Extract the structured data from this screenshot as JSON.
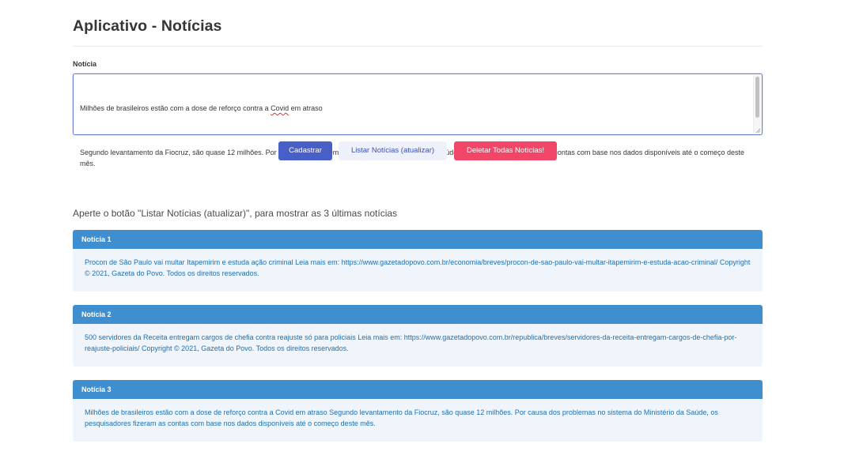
{
  "app": {
    "title": "Aplicativo - Notícias"
  },
  "form": {
    "label": "Notícia",
    "textarea_line1_before": "Milhões de brasileiros estão com a dose de reforço contra a ",
    "textarea_line1_spell": "Covid",
    "textarea_line1_after": " em atraso",
    "textarea_paragraph2": "Segundo levantamento da Fiocruz, são quase 12 milhões. Por causa dos problemas no sistema do Ministério da Saúde, os pesquisadores fizeram as contas com base nos dados disponíveis até o começo deste mês."
  },
  "buttons": {
    "cadastrar": "Cadastrar",
    "listar": "Listar Notícias (atualizar)",
    "deletar": "Deletar Todas Notícias!"
  },
  "hint": "Aperte o botão \"Listar Notícias (atualizar)\", para mostrar as 3 últimas notícias",
  "news": [
    {
      "title": "Notícia 1",
      "body": "Procon de São Paulo vai multar Itapemirim e estuda ação criminal Leia mais em: https://www.gazetadopovo.com.br/economia/breves/procon-de-sao-paulo-vai-multar-itapemirim-e-estuda-acao-criminal/ Copyright © 2021, Gazeta do Povo. Todos os direitos reservados."
    },
    {
      "title": "Notícia 2",
      "body": "500 servidores da Receita entregam cargos de chefia contra reajuste só para policiais Leia mais em: https://www.gazetadopovo.com.br/republica/breves/servidores-da-receita-entregam-cargos-de-chefia-por-reajuste-policiais/ Copyright © 2021, Gazeta do Povo. Todos os direitos reservados."
    },
    {
      "title": "Notícia 3",
      "body": "Milhões de brasileiros estão com a dose de reforço contra a Covid em atraso Segundo levantamento da Fiocruz, são quase 12 milhões. Por causa dos problemas no sistema do Ministério da Saúde, os pesquisadores fizeram as contas com base nos dados disponíveis até o começo deste mês."
    }
  ],
  "colors": {
    "primary": "#485fc7",
    "light_button": "#eff1fa",
    "danger": "#f14668",
    "info_header": "#3e8ed0",
    "info_body": "#eff5fb"
  }
}
